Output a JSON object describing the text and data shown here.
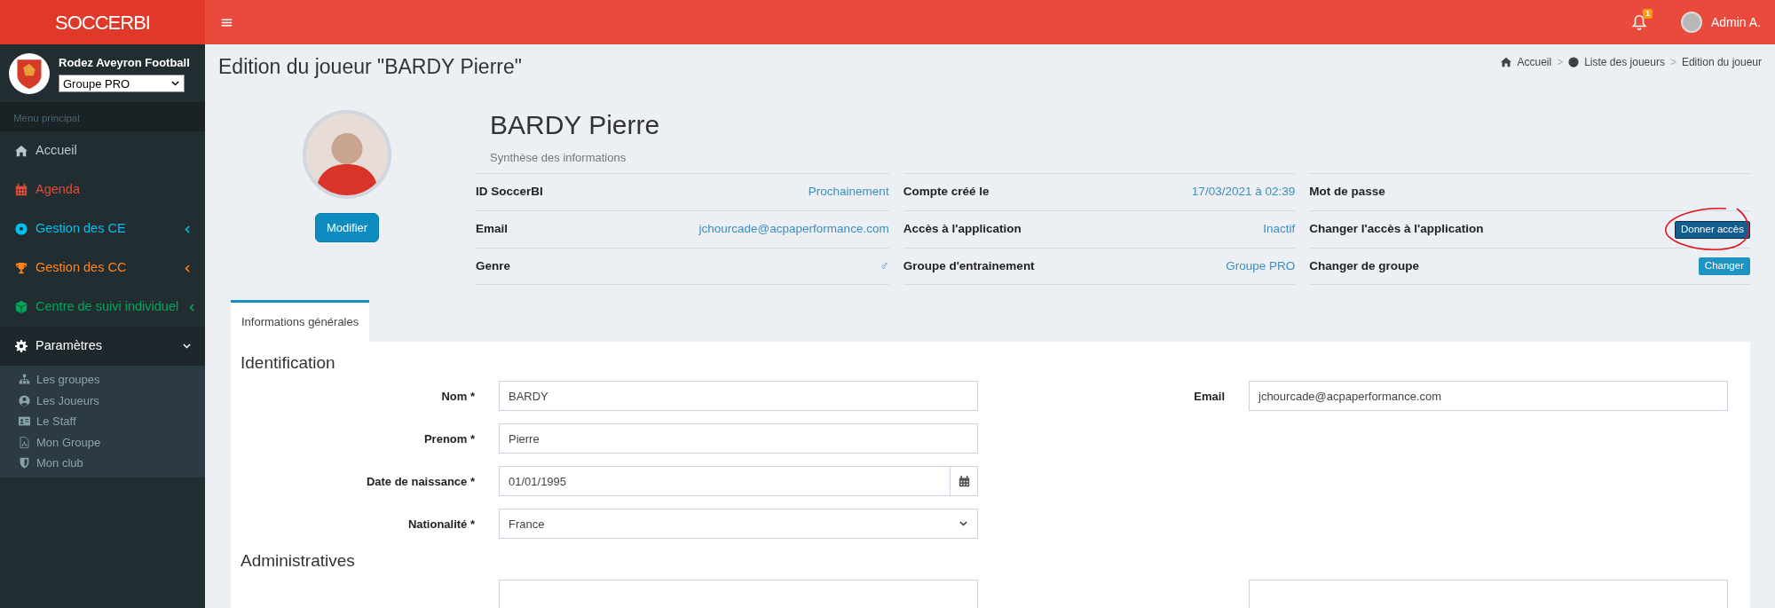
{
  "header": {
    "logo": "SOCCERBI",
    "notification_count": "1",
    "user": "Admin A."
  },
  "sidebar": {
    "club": "Rodez Aveyron Football",
    "group_select": "Groupe PRO",
    "section": "Menu principal",
    "items": [
      {
        "label": "Accueil",
        "color": "#b8c7ce"
      },
      {
        "label": "Agenda",
        "color": "#dd4b39"
      },
      {
        "label": "Gestion des CE",
        "color": "#00c0ef",
        "expanded": false
      },
      {
        "label": "Gestion des CC",
        "color": "#ff851b",
        "expanded": false
      },
      {
        "label": "Centre de suivi individuel",
        "color": "#00a65a",
        "expanded": false
      },
      {
        "label": "Paramètres",
        "color": "#ffffff",
        "expanded": true,
        "children": [
          {
            "label": "Les groupes"
          },
          {
            "label": "Les Joueurs"
          },
          {
            "label": "Le Staff"
          },
          {
            "label": "Mon Groupe"
          },
          {
            "label": "Mon club"
          }
        ]
      }
    ]
  },
  "page": {
    "title": "Edition du joueur \"BARDY Pierre\"",
    "breadcrumb": [
      "Accueil",
      "Liste des joueurs",
      "Edition du joueur"
    ],
    "breadcrumb_separator": ">"
  },
  "profile": {
    "button": "Modifier",
    "name": "BARDY Pierre",
    "subtitle": "Synthèse des informations",
    "columns": [
      [
        {
          "label": "ID SoccerBI",
          "value": "Prochainement",
          "kind": "text"
        },
        {
          "label": "Email",
          "value": "jchourcade@acpaperformance.com",
          "kind": "text"
        },
        {
          "label": "Genre",
          "value": "♂",
          "kind": "text"
        }
      ],
      [
        {
          "label": "Compte créé le",
          "value": "17/03/2021 à 02:39",
          "kind": "text"
        },
        {
          "label": "Accès à l'application",
          "value": "Inactif",
          "kind": "text"
        },
        {
          "label": "Groupe d'entrainement",
          "value": "Groupe PRO",
          "kind": "text"
        }
      ],
      [
        {
          "label": "Mot de passe",
          "kind": "none"
        },
        {
          "label": "Changer l'accès à l'application",
          "value": "Donner accès",
          "kind": "button",
          "focused": true
        },
        {
          "label": "Changer de groupe",
          "value": "Changer",
          "kind": "button",
          "focused": false
        }
      ]
    ]
  },
  "tabs": [
    {
      "label": "Informations générales",
      "selected": true
    }
  ],
  "sections": [
    {
      "title": "Identification",
      "rows": [
        {
          "left": {
            "label": "Nom *",
            "value": "BARDY",
            "kind": "text"
          },
          "right": {
            "label": "Email",
            "value": "jchourcade@acpaperformance.com",
            "kind": "text"
          }
        },
        {
          "left": {
            "label": "Prenom *",
            "value": "Pierre",
            "kind": "text"
          }
        },
        {
          "left": {
            "label": "Date de naissance *",
            "value": "01/01/1995",
            "kind": "date"
          }
        },
        {
          "left": {
            "label": "Nationalité *",
            "value": "France",
            "kind": "select"
          }
        }
      ]
    },
    {
      "title": "Administratives",
      "rows": [
        {
          "left": {
            "kind": "cut"
          },
          "right": {
            "kind": "cut"
          }
        }
      ]
    }
  ]
}
